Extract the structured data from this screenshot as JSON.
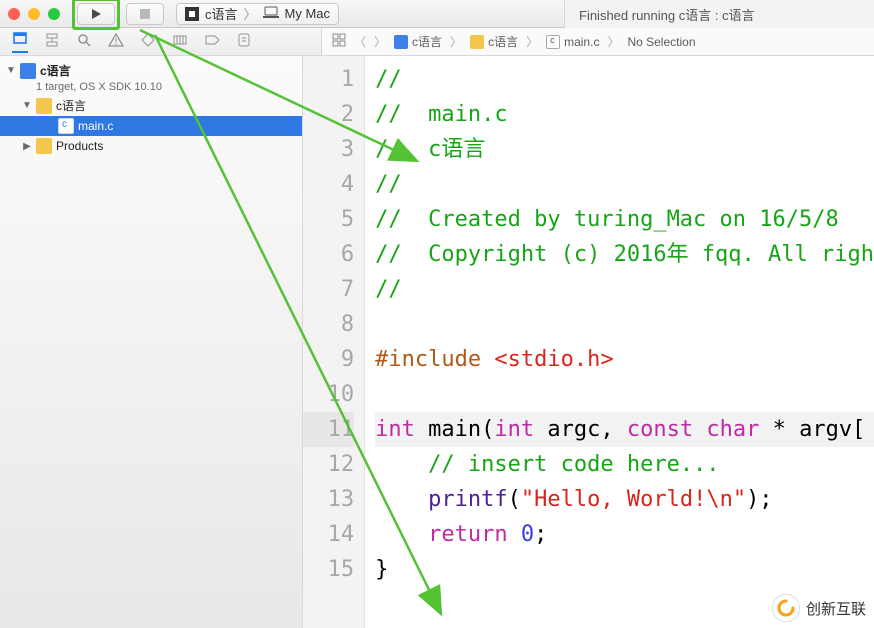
{
  "toolbar": {
    "scheme_target": "c语言",
    "scheme_device": "My Mac",
    "status": "Finished running c语言 : c语言"
  },
  "jumpbar": {
    "items": [
      "c语言",
      "c语言",
      "main.c",
      "No Selection"
    ]
  },
  "tree": {
    "project": {
      "name": "c语言",
      "sub": "1 target, OS X SDK 10.10"
    },
    "folder": {
      "name": "c语言"
    },
    "file": {
      "name": "main.c"
    },
    "products": {
      "name": "Products"
    }
  },
  "code": {
    "lines": [
      {
        "n": "1",
        "seg": [
          {
            "cls": "cmt",
            "t": "//"
          }
        ]
      },
      {
        "n": "2",
        "seg": [
          {
            "cls": "cmt",
            "t": "//  main.c"
          }
        ]
      },
      {
        "n": "3",
        "seg": [
          {
            "cls": "cmt",
            "t": "//  c语言"
          }
        ]
      },
      {
        "n": "4",
        "seg": [
          {
            "cls": "cmt",
            "t": "//"
          }
        ]
      },
      {
        "n": "5",
        "seg": [
          {
            "cls": "cmt",
            "t": "//  Created by turing_Mac on 16/5/8"
          }
        ]
      },
      {
        "n": "6",
        "seg": [
          {
            "cls": "cmt",
            "t": "//  Copyright (c) 2016年 fqq. All righ"
          }
        ]
      },
      {
        "n": "7",
        "seg": [
          {
            "cls": "cmt",
            "t": "//"
          }
        ]
      },
      {
        "n": "8",
        "seg": []
      },
      {
        "n": "9",
        "seg": [
          {
            "cls": "pre",
            "t": "#include "
          },
          {
            "cls": "ang",
            "t": "<stdio.h>"
          }
        ]
      },
      {
        "n": "10",
        "seg": []
      },
      {
        "n": "11",
        "hl": true,
        "seg": [
          {
            "cls": "kw",
            "t": "int"
          },
          {
            "cls": "",
            "t": " main("
          },
          {
            "cls": "kw",
            "t": "int"
          },
          {
            "cls": "",
            "t": " argc, "
          },
          {
            "cls": "kw",
            "t": "const"
          },
          {
            "cls": "",
            "t": " "
          },
          {
            "cls": "kw",
            "t": "char"
          },
          {
            "cls": "",
            "t": " * argv["
          }
        ]
      },
      {
        "n": "12",
        "seg": [
          {
            "cls": "",
            "t": "    "
          },
          {
            "cls": "cmt",
            "t": "// insert code here..."
          }
        ]
      },
      {
        "n": "13",
        "seg": [
          {
            "cls": "",
            "t": "    "
          },
          {
            "cls": "fn",
            "t": "printf"
          },
          {
            "cls": "",
            "t": "("
          },
          {
            "cls": "str",
            "t": "\"Hello, World!\\n\""
          },
          {
            "cls": "",
            "t": ");"
          }
        ]
      },
      {
        "n": "14",
        "seg": [
          {
            "cls": "",
            "t": "    "
          },
          {
            "cls": "kw",
            "t": "return"
          },
          {
            "cls": "",
            "t": " "
          },
          {
            "cls": "num",
            "t": "0"
          },
          {
            "cls": "",
            "t": ";"
          }
        ]
      },
      {
        "n": "15",
        "seg": [
          {
            "cls": "",
            "t": "}"
          }
        ]
      }
    ]
  },
  "watermark": "创新互联"
}
